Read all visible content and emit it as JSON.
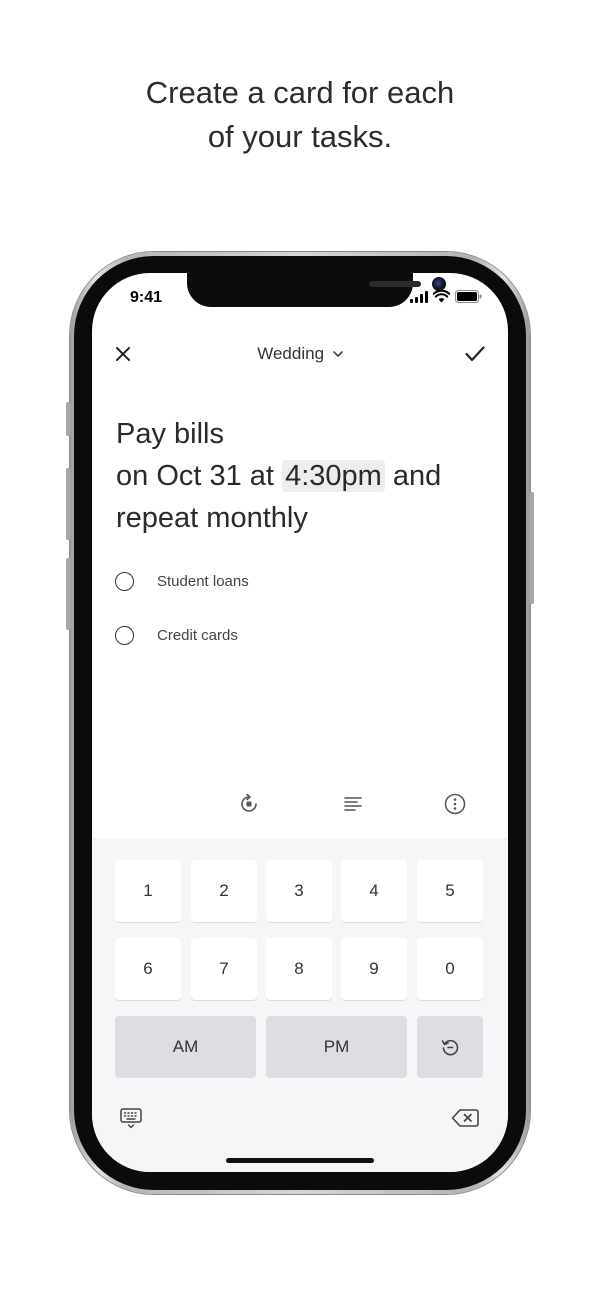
{
  "promo": {
    "headline_line1": "Create a card for each",
    "headline_line2": "of your tasks."
  },
  "status_bar": {
    "time": "9:41",
    "icons": [
      "cellular-signal-icon",
      "wifi-icon",
      "battery-icon"
    ]
  },
  "nav": {
    "close_icon": "close-icon",
    "list_name": "Wedding",
    "dropdown_icon": "chevron-down-icon",
    "confirm_icon": "checkmark-icon"
  },
  "task": {
    "title": "Pay bills",
    "date_prefix": "on Oct 31 at",
    "time_selected": "4:30pm",
    "date_suffix": "and",
    "repeat": "repeat monthly"
  },
  "subtasks": [
    {
      "label": "Student loans",
      "checked": false
    },
    {
      "label": "Credit cards",
      "checked": false
    }
  ],
  "toolbar": {
    "icons": [
      "repeat-icon",
      "notes-icon",
      "more-options-icon"
    ]
  },
  "keypad": {
    "row1": [
      "1",
      "2",
      "3",
      "4",
      "5"
    ],
    "row2": [
      "6",
      "7",
      "8",
      "9",
      "0"
    ],
    "am_label": "AM",
    "pm_label": "PM",
    "reset_icon": "reset-time-icon",
    "keyboard_icon": "keyboard-icon",
    "delete_icon": "backspace-icon"
  },
  "colors": {
    "accent": "#2a2a2a",
    "time_highlight": "#ededed",
    "keypad_background": "#f5f6f8",
    "key_grey": "#dddee1"
  }
}
